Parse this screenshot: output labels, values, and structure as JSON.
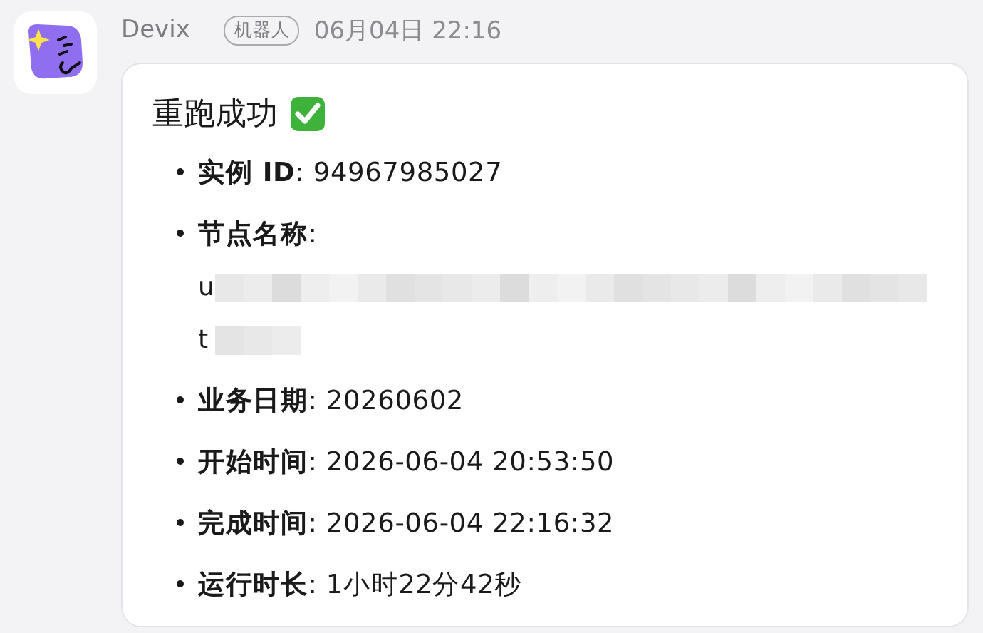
{
  "sender": {
    "name": "Devix",
    "badge": "机器人",
    "time": "06月04日 22:16"
  },
  "message": {
    "title": "重跑成功",
    "items": [
      {
        "kind": "text",
        "text": "**实例 ID**: 94967985027"
      },
      {
        "kind": "redacted",
        "text": "**节点名称**:",
        "lines": [
          "u",
          "t"
        ]
      },
      {
        "kind": "text",
        "text": "**业务日期**: 20260602"
      },
      {
        "kind": "text",
        "text": "**开始时间**: 2026-06-04 20:53:50"
      },
      {
        "kind": "text",
        "text": "**完成时间**: 2026-06-04 22:16:32"
      },
      {
        "kind": "text",
        "text": "**运行时长**: 1小时22分42秒"
      }
    ]
  }
}
